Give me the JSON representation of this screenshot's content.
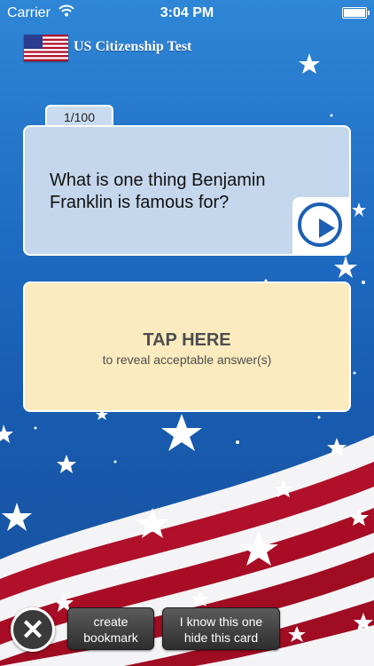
{
  "status_bar": {
    "carrier": "Carrier",
    "time": "3:04 PM"
  },
  "header": {
    "title": "US Citizenship Test",
    "flag_icon": "us-flag-icon"
  },
  "question_card": {
    "counter": "1/100",
    "question": "What is one thing Benjamin Franklin is famous for?",
    "play_icon": "play-circle-icon"
  },
  "answer_card": {
    "tap_label": "TAP HERE",
    "reveal_label": "to reveal acceptable answer(s)"
  },
  "toolbar": {
    "close_icon": "close-x-icon",
    "bookmark_line1": "create",
    "bookmark_line2": "bookmark",
    "hide_line1": "I know this one",
    "hide_line2": "hide this card"
  },
  "colors": {
    "background_blue": "#1f6cc4",
    "question_card": "#c5d7ec",
    "answer_card": "#fbebbf",
    "stripe_red": "#b0102a",
    "play_blue": "#1d5fb3"
  }
}
